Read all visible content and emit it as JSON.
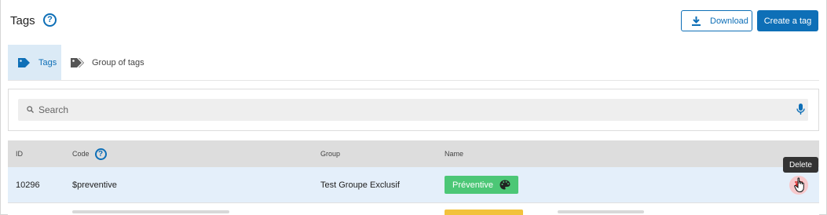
{
  "header": {
    "title": "Tags",
    "download_label": "Download",
    "create_label": "Create a tag"
  },
  "tabs": [
    {
      "label": "Tags",
      "icon": "tag-icon",
      "active": true
    },
    {
      "label": "Group of tags",
      "icon": "tags-group-icon",
      "active": false
    }
  ],
  "search": {
    "placeholder": "Search",
    "value": ""
  },
  "table": {
    "columns": [
      "ID",
      "Code",
      "Group",
      "Name"
    ],
    "rows": [
      {
        "id": "10296",
        "code": "$preventive",
        "group": "Test Groupe Exclusif",
        "name": "Préventive",
        "name_color": "#4cc776"
      }
    ]
  },
  "tooltip": {
    "text": "Delete"
  },
  "colors": {
    "accent": "#0e6fb7",
    "danger": "#e02f2f",
    "row_highlight": "#e4effa"
  }
}
